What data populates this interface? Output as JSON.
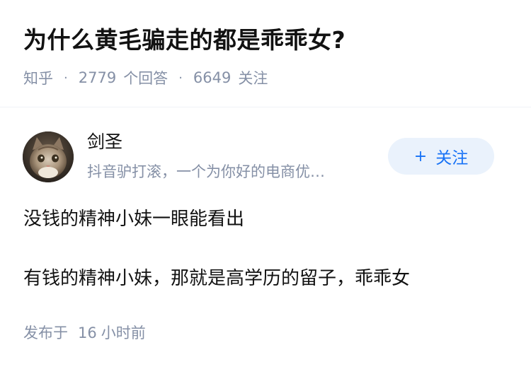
{
  "question": {
    "title": "为什么黄毛骗走的都是乖乖女?",
    "source": "知乎",
    "answer_count": "2779",
    "answer_label": "个回答",
    "follower_count": "6649",
    "follower_label": "关注",
    "separator": "·"
  },
  "answer": {
    "author": {
      "name": "剑圣",
      "bio": "抖音驴打滚，一个为你好的电商优…",
      "avatar_icon": "cat-avatar"
    },
    "follow_button": {
      "icon": "+",
      "label": "关注"
    },
    "lines": [
      "没钱的精神小妹一眼能看出",
      "有钱的精神小妹，那就是高学历的留子，乖乖女"
    ],
    "published_prefix": "发布于",
    "published_value": "16",
    "published_unit": "小时前"
  },
  "colors": {
    "muted": "#8590a6",
    "accent": "#1772f6",
    "button_bg": "#eaf2fc"
  }
}
